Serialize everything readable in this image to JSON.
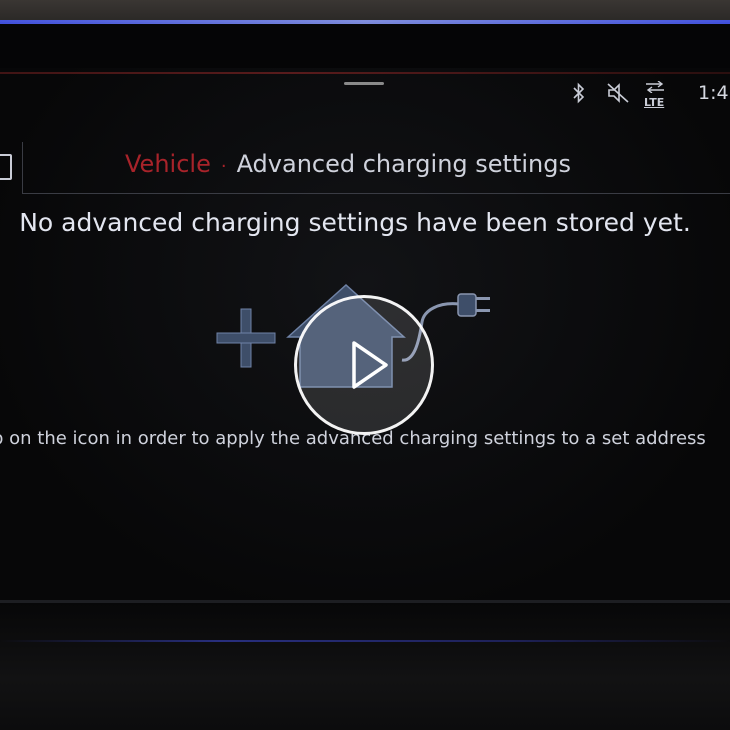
{
  "status_bar": {
    "icons": [
      "bluetooth-icon",
      "mute-icon",
      "lte-icon"
    ],
    "lte_label": "LTE",
    "clock": "1:4"
  },
  "header": {
    "breadcrumb_parent": "Vehicle",
    "breadcrumb_separator": "·",
    "breadcrumb_current": "Advanced charging settings"
  },
  "main": {
    "message": "No advanced charging settings have been stored yet.",
    "hint": "p on the icon in order to apply the advanced charging settings to a set address"
  },
  "overlay": {
    "icon": "play-icon"
  },
  "colors": {
    "accent_red": "#a8232a",
    "text": "#e3e6f0",
    "icon_fill": "#3e4e69",
    "background": "#0b0b0c"
  }
}
